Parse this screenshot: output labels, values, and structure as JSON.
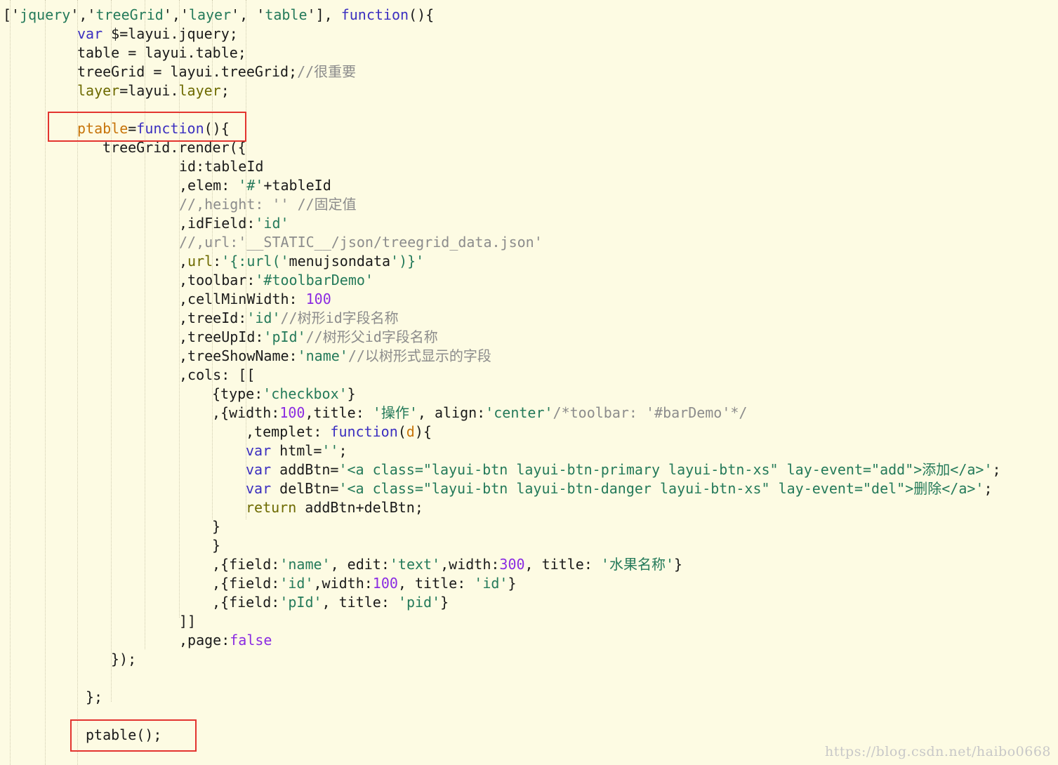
{
  "editor": {
    "lines": [
      [
        {
          "t": "['",
          "k": "plain"
        },
        {
          "t": "jquery",
          "k": "string"
        },
        {
          "t": "','",
          "k": "plain"
        },
        {
          "t": "treeGrid",
          "k": "string"
        },
        {
          "t": "','",
          "k": "plain"
        },
        {
          "t": "layer",
          "k": "string"
        },
        {
          "t": "', '",
          "k": "plain"
        },
        {
          "t": "table",
          "k": "string"
        },
        {
          "t": "'], ",
          "k": "plain"
        },
        {
          "t": "function",
          "k": "keyword"
        },
        {
          "t": "(){",
          "k": "plain"
        }
      ],
      [
        {
          "t": "var",
          "k": "keyword"
        },
        {
          "t": " $=layui.jquery;",
          "k": "plain"
        }
      ],
      [
        {
          "t": "table = layui.table;",
          "k": "plain"
        }
      ],
      [
        {
          "t": "treeGrid = layui.treeGrid;",
          "k": "plain"
        },
        {
          "t": "//很重要",
          "k": "comment"
        }
      ],
      [
        {
          "t": "layer",
          "k": "prop"
        },
        {
          "t": "=layui.",
          "k": "plain"
        },
        {
          "t": "layer",
          "k": "prop"
        },
        {
          "t": ";",
          "k": "plain"
        }
      ],
      [
        {
          "t": "ptable",
          "k": "func"
        },
        {
          "t": "=",
          "k": "plain"
        },
        {
          "t": "function",
          "k": "keyword"
        },
        {
          "t": "(){",
          "k": "plain"
        }
      ],
      [
        {
          "t": "treeGrid.render({",
          "k": "plain"
        }
      ],
      [
        {
          "t": "id:tableId",
          "k": "plain"
        }
      ],
      [
        {
          "t": ",elem: ",
          "k": "plain"
        },
        {
          "t": "'#'",
          "k": "string"
        },
        {
          "t": "+tableId",
          "k": "plain"
        }
      ],
      [
        {
          "t": "//,height: '' //固定值",
          "k": "comment"
        }
      ],
      [
        {
          "t": ",idField:",
          "k": "plain"
        },
        {
          "t": "'id'",
          "k": "string"
        }
      ],
      [
        {
          "t": "//,url:'__STATIC__/json/treegrid_data.json'",
          "k": "comment"
        }
      ],
      [
        {
          "t": ",",
          "k": "plain"
        },
        {
          "t": "url",
          "k": "prop"
        },
        {
          "t": ":",
          "k": "plain"
        },
        {
          "t": "'{:url('",
          "k": "string"
        },
        {
          "t": "menujsondata",
          "k": "plain"
        },
        {
          "t": "')}'",
          "k": "string"
        }
      ],
      [
        {
          "t": ",toolbar:",
          "k": "plain"
        },
        {
          "t": "'#toolbarDemo'",
          "k": "string"
        }
      ],
      [
        {
          "t": ",cellMinWidth: ",
          "k": "plain"
        },
        {
          "t": "100",
          "k": "number"
        }
      ],
      [
        {
          "t": ",treeId:",
          "k": "plain"
        },
        {
          "t": "'id'",
          "k": "string"
        },
        {
          "t": "//树形id字段名称",
          "k": "comment"
        }
      ],
      [
        {
          "t": ",treeUpId:",
          "k": "plain"
        },
        {
          "t": "'pId'",
          "k": "string"
        },
        {
          "t": "//树形父id字段名称",
          "k": "comment"
        }
      ],
      [
        {
          "t": ",treeShowName:",
          "k": "plain"
        },
        {
          "t": "'name'",
          "k": "string"
        },
        {
          "t": "//以树形式显示的字段",
          "k": "comment"
        }
      ],
      [
        {
          "t": ",cols: [[",
          "k": "plain"
        }
      ],
      [
        {
          "t": "{type:",
          "k": "plain"
        },
        {
          "t": "'checkbox'",
          "k": "string"
        },
        {
          "t": "}",
          "k": "plain"
        }
      ],
      [
        {
          "t": ",{width:",
          "k": "plain"
        },
        {
          "t": "100",
          "k": "number"
        },
        {
          "t": ",title: ",
          "k": "plain"
        },
        {
          "t": "'操作'",
          "k": "string"
        },
        {
          "t": ", align:",
          "k": "plain"
        },
        {
          "t": "'center'",
          "k": "string"
        },
        {
          "t": "/*toolbar: '#barDemo'*/",
          "k": "comment"
        }
      ],
      [
        {
          "t": ",templet: ",
          "k": "plain"
        },
        {
          "t": "function",
          "k": "keyword"
        },
        {
          "t": "(",
          "k": "plain"
        },
        {
          "t": "d",
          "k": "func"
        },
        {
          "t": "){",
          "k": "plain"
        }
      ],
      [
        {
          "t": "var",
          "k": "keyword"
        },
        {
          "t": " html=",
          "k": "plain"
        },
        {
          "t": "''",
          "k": "string"
        },
        {
          "t": ";",
          "k": "plain"
        }
      ],
      [
        {
          "t": "var",
          "k": "keyword"
        },
        {
          "t": " addBtn=",
          "k": "plain"
        },
        {
          "t": "'<a class=\"layui-btn layui-btn-primary layui-btn-xs\" lay-event=\"add\">添加</a>'",
          "k": "string"
        },
        {
          "t": ";",
          "k": "plain"
        }
      ],
      [
        {
          "t": "var",
          "k": "keyword"
        },
        {
          "t": " delBtn=",
          "k": "plain"
        },
        {
          "t": "'<a class=\"layui-btn layui-btn-danger layui-btn-xs\" lay-event=\"del\">删除</a>'",
          "k": "string"
        },
        {
          "t": ";",
          "k": "plain"
        }
      ],
      [
        {
          "t": "return",
          "k": "prop"
        },
        {
          "t": " addBtn+delBtn;",
          "k": "plain"
        }
      ],
      [
        {
          "t": "}",
          "k": "plain"
        }
      ],
      [
        {
          "t": "}",
          "k": "plain"
        }
      ],
      [
        {
          "t": ",{field:",
          "k": "plain"
        },
        {
          "t": "'name'",
          "k": "string"
        },
        {
          "t": ", edit:",
          "k": "plain"
        },
        {
          "t": "'text'",
          "k": "string"
        },
        {
          "t": ",width:",
          "k": "plain"
        },
        {
          "t": "300",
          "k": "number"
        },
        {
          "t": ", title: ",
          "k": "plain"
        },
        {
          "t": "'水果名称'",
          "k": "string"
        },
        {
          "t": "}",
          "k": "plain"
        }
      ],
      [
        {
          "t": ",{field:",
          "k": "plain"
        },
        {
          "t": "'id'",
          "k": "string"
        },
        {
          "t": ",width:",
          "k": "plain"
        },
        {
          "t": "100",
          "k": "number"
        },
        {
          "t": ", title: ",
          "k": "plain"
        },
        {
          "t": "'id'",
          "k": "string"
        },
        {
          "t": "}",
          "k": "plain"
        }
      ],
      [
        {
          "t": ",{field:",
          "k": "plain"
        },
        {
          "t": "'pId'",
          "k": "string"
        },
        {
          "t": ", title: ",
          "k": "plain"
        },
        {
          "t": "'pid'",
          "k": "string"
        },
        {
          "t": "}",
          "k": "plain"
        }
      ],
      [
        {
          "t": "]]",
          "k": "plain"
        }
      ],
      [
        {
          "t": ",page:",
          "k": "plain"
        },
        {
          "t": "false",
          "k": "number"
        }
      ],
      [
        {
          "t": "});",
          "k": "plain"
        }
      ],
      [
        {
          "t": "};",
          "k": "plain"
        }
      ],
      [
        {
          "t": "ptable();",
          "k": "plain"
        }
      ]
    ]
  },
  "colors": {
    "background": "#fdfbe3",
    "plain": "#1a1a1a",
    "keyword": "#3b2fc0",
    "string": "#247a5a",
    "number": "#8a2be2",
    "comment": "#8c8c8c",
    "function_name": "#c7740a",
    "property": "#6d6a00",
    "highlight_box": "#e3342f"
  },
  "watermark": "https://blog.csdn.net/haibo0668"
}
